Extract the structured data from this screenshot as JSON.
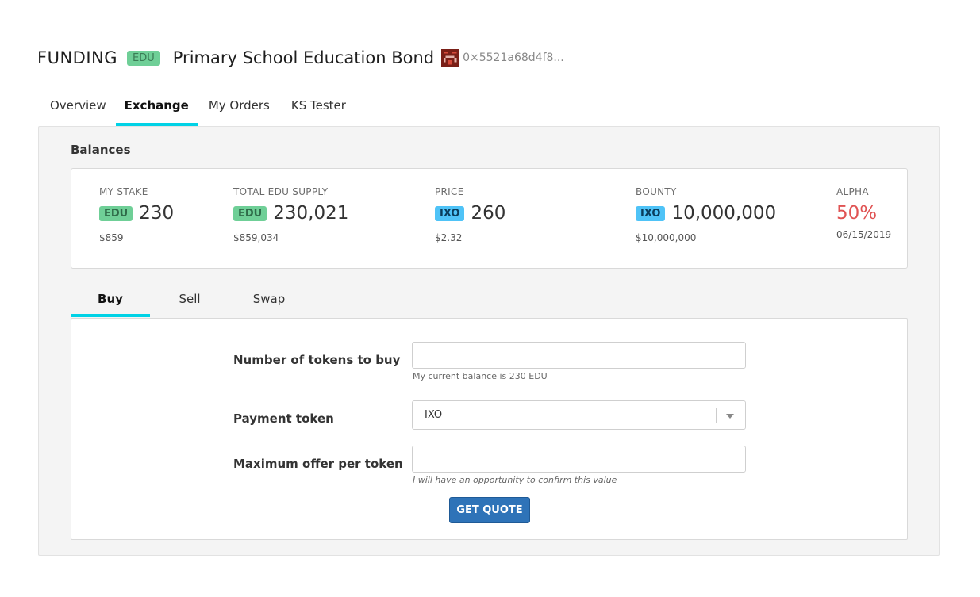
{
  "header": {
    "category": "FUNDING",
    "token_badge": "EDU",
    "title": "Primary School Education Bond",
    "address": "0×5521a68d4f8..."
  },
  "nav": {
    "tabs": [
      {
        "label": "Overview",
        "active": false
      },
      {
        "label": "Exchange",
        "active": true
      },
      {
        "label": "My Orders",
        "active": false
      },
      {
        "label": "KS Tester",
        "active": false
      }
    ]
  },
  "balances": {
    "heading": "Balances",
    "stats": [
      {
        "label": "MY STAKE",
        "badge": "EDU",
        "value": "230",
        "sub": "$859"
      },
      {
        "label": "TOTAL EDU SUPPLY",
        "badge": "EDU",
        "value": "230,021",
        "sub": "$859,034"
      },
      {
        "label": "PRICE",
        "badge": "IXO",
        "value": "260",
        "sub": "$2.32"
      },
      {
        "label": "BOUNTY",
        "badge": "IXO",
        "value": "10,000,000",
        "sub": "$10,000,000"
      },
      {
        "label": "ALPHA",
        "value": "50%",
        "sub": "06/15/2019"
      }
    ]
  },
  "trade": {
    "tabs": [
      {
        "label": "Buy",
        "active": true
      },
      {
        "label": "Sell",
        "active": false
      },
      {
        "label": "Swap",
        "active": false
      }
    ],
    "tokens_label": "Number of tokens to buy",
    "tokens_value": "",
    "tokens_help": "My current balance is 230 EDU",
    "payment_label": "Payment token",
    "payment_value": "IXO",
    "max_offer_label": "Maximum offer per token",
    "max_offer_value": "",
    "max_offer_help": "I will have an opportunity to confirm this value",
    "quote_button": "GET QUOTE"
  },
  "colors": {
    "accent": "#00d2e6",
    "edu_badge": "#6fcf97",
    "ixo_badge": "#4fc3f7",
    "alpha_value": "#e05353",
    "button": "#2e73b8"
  },
  "icons": {
    "identicon": "pixel-avatar-icon",
    "select_arrow": "chevron-down-icon"
  }
}
